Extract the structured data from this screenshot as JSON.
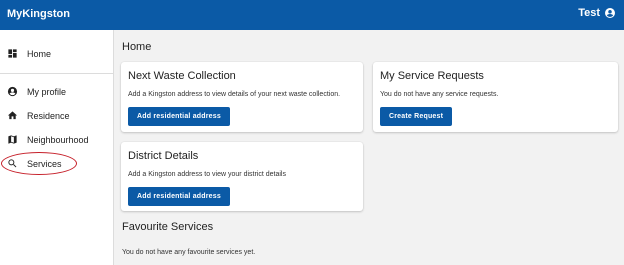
{
  "header": {
    "app_title": "MyKingston",
    "user_name": "Test"
  },
  "sidebar": {
    "items": [
      {
        "label": "Home",
        "icon": "dashboard-icon"
      },
      {
        "label": "My profile",
        "icon": "account-circle-icon"
      },
      {
        "label": "Residence",
        "icon": "house-icon"
      },
      {
        "label": "Neighbourhood",
        "icon": "map-icon"
      },
      {
        "label": "Services",
        "icon": "search-icon"
      }
    ],
    "highlight_color": "#c6202a"
  },
  "main": {
    "page_title": "Home",
    "cards": {
      "waste": {
        "title": "Next Waste Collection",
        "text": "Add a Kingston address to view details of your next waste collection.",
        "button": "Add residential address"
      },
      "requests": {
        "title": "My Service Requests",
        "text": "You do not have any service requests.",
        "button": "Create Request"
      },
      "district": {
        "title": "District Details",
        "text": "Add a Kingston address to view your district details",
        "button": "Add residential address"
      }
    },
    "favourites": {
      "title": "Favourite Services",
      "text": "You do not have any favourite services yet."
    }
  },
  "colors": {
    "brand": "#0b5aa6",
    "background": "#f2f2f2"
  }
}
